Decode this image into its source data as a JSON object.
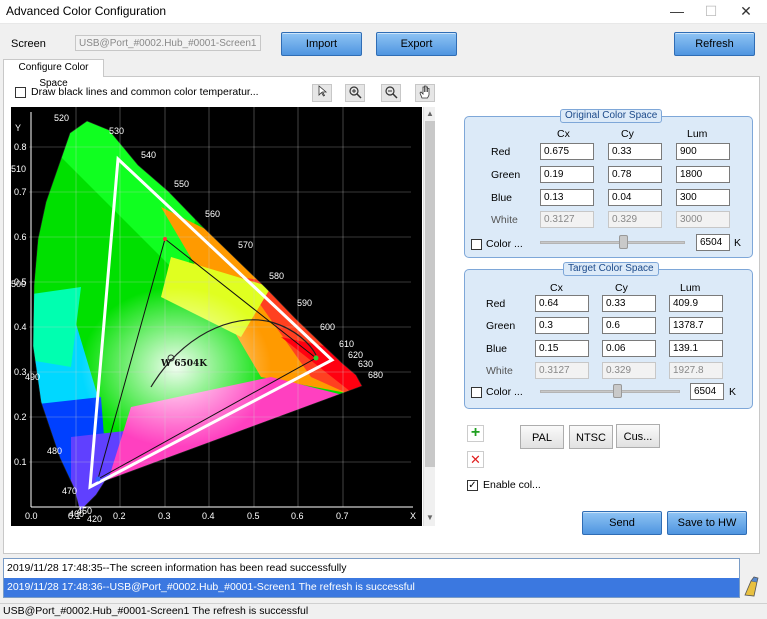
{
  "window": {
    "title": "Advanced Color Configuration",
    "min": "—",
    "max": "☐",
    "close": "✕"
  },
  "screen": {
    "label": "Screen",
    "value": "USB@Port_#0002.Hub_#0001-Screen1"
  },
  "buttons": {
    "import": "Import",
    "export": "Export",
    "refresh": "Refresh",
    "send": "Send",
    "save": "Save to HW",
    "pal": "PAL",
    "ntsc": "NTSC",
    "custom": "Cus..."
  },
  "tab": {
    "label": "Configure Color Space"
  },
  "draw_lines": {
    "label": "Draw black lines and common color temperatur..."
  },
  "chart": {
    "y_axis_label": "Y",
    "x_axis_label": "X",
    "x_ticks": [
      "0.0",
      "0.1",
      "0.2",
      "0.3",
      "0.4",
      "0.5",
      "0.6",
      "0.7"
    ],
    "y_ticks": [
      "0.8",
      "0.7",
      "0.6",
      "0.5",
      "0.4",
      "0.3",
      "0.2",
      "0.1"
    ],
    "wavelengths": [
      "520",
      "530",
      "540",
      "550",
      "560",
      "570",
      "580",
      "590",
      "600",
      "610",
      "620",
      "630",
      "680",
      "510",
      "500",
      "490",
      "480",
      "470",
      "460",
      "450",
      "420"
    ],
    "white_point_label": "W 6504K"
  },
  "original": {
    "title": "Original Color Space",
    "headers": [
      "Cx",
      "Cy",
      "Lum"
    ],
    "rows": [
      {
        "label": "Red",
        "cx": "0.675",
        "cy": "0.33",
        "lum": "900"
      },
      {
        "label": "Green",
        "cx": "0.19",
        "cy": "0.78",
        "lum": "1800"
      },
      {
        "label": "Blue",
        "cx": "0.13",
        "cy": "0.04",
        "lum": "300"
      },
      {
        "label": "White",
        "cx": "0.3127",
        "cy": "0.329",
        "lum": "3000"
      }
    ],
    "color_label": "Color ...",
    "temp": "6504",
    "unit": "K"
  },
  "target": {
    "title": "Target Color Space",
    "headers": [
      "Cx",
      "Cy",
      "Lum"
    ],
    "rows": [
      {
        "label": "Red",
        "cx": "0.64",
        "cy": "0.33",
        "lum": "409.9"
      },
      {
        "label": "Green",
        "cx": "0.3",
        "cy": "0.6",
        "lum": "1378.7"
      },
      {
        "label": "Blue",
        "cx": "0.15",
        "cy": "0.06",
        "lum": "139.1"
      },
      {
        "label": "White",
        "cx": "0.3127",
        "cy": "0.329",
        "lum": "1927.8"
      }
    ],
    "color_label": "Color ...",
    "temp": "6504",
    "unit": "K"
  },
  "enable": {
    "label": "Enable col...",
    "checked": true
  },
  "log": [
    "2019/11/28 17:48:35--The screen information has been read successfully",
    "2019/11/28 17:48:36--USB@Port_#0002.Hub_#0001-Screen1 The refresh is successful"
  ],
  "status": "USB@Port_#0002.Hub_#0001-Screen1 The refresh is successful"
}
